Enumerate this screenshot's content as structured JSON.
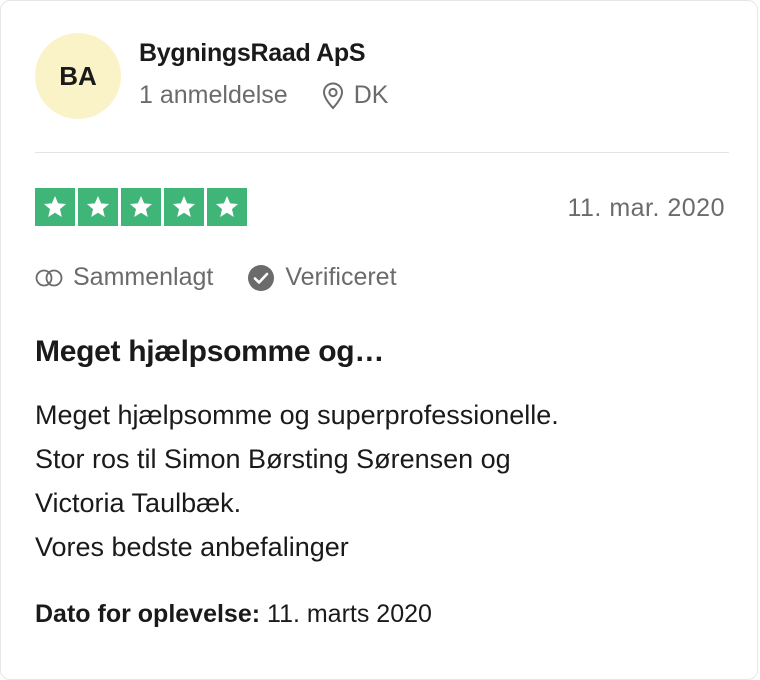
{
  "reviewer": {
    "initials": "BA",
    "name": "BygningsRaad ApS",
    "review_count": "1 anmeldelse",
    "country": "DK"
  },
  "rating": {
    "stars": 5,
    "max_stars": 5,
    "color": "#3fb578"
  },
  "review": {
    "date": "11. mar. 2020",
    "merged_label": "Sammenlagt",
    "verified_label": "Verificeret",
    "title": "Meget hjælpsomme og…",
    "body_lines": [
      "Meget hjælpsomme og superprofessionelle.",
      "Stor ros til Simon Børsting Sørensen og",
      "Victoria Taulbæk.",
      "Vores bedste anbefalinger"
    ],
    "experience_label": "Dato for oplevelse:",
    "experience_date": "11. marts 2020"
  },
  "icons": {
    "location": "map-pin-icon",
    "merged": "merged-circles-icon",
    "verified": "verified-check-icon",
    "star": "star-icon"
  },
  "colors": {
    "avatar_bg": "#fbf3c8",
    "muted_text": "#6b6b6b"
  }
}
